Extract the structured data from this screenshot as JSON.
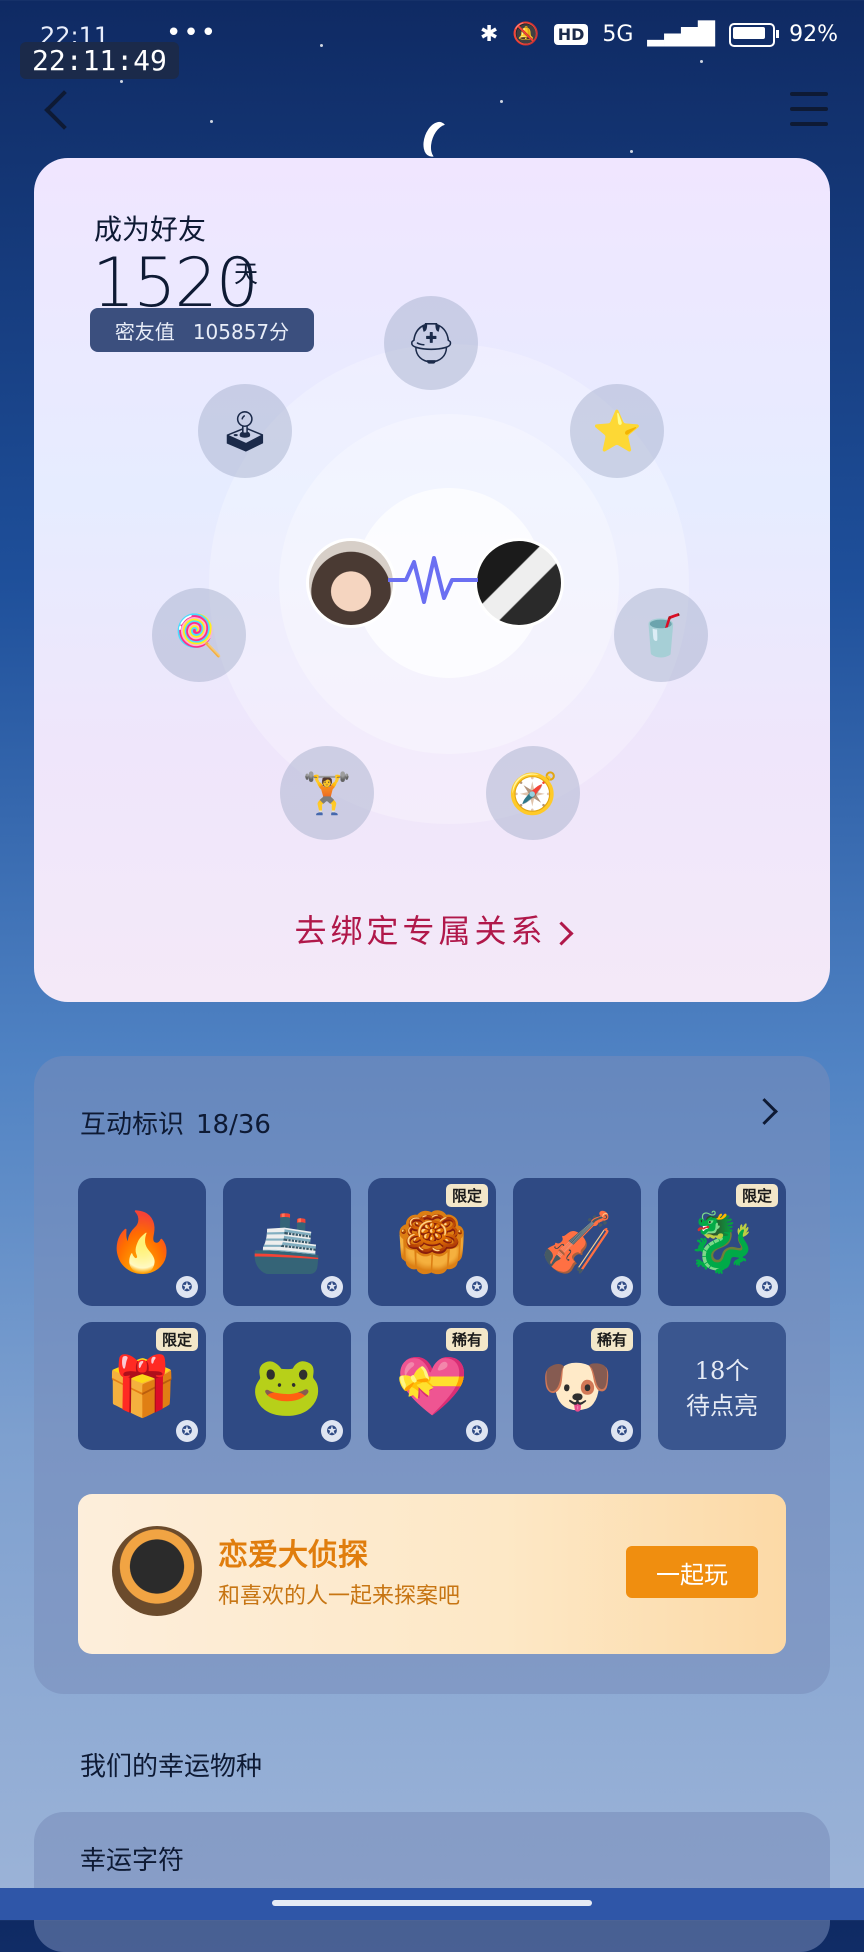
{
  "status_bar": {
    "time_small": "22:11",
    "time_overlay": "22:11:49",
    "more": "•••",
    "hd": "HD",
    "network": "5G",
    "battery": "92%"
  },
  "nav": {
    "back_icon": "back-chevron-icon",
    "menu_icon": "menu-icon"
  },
  "friendship": {
    "title": "成为好友",
    "days": "1520",
    "days_unit": "天",
    "intimacy_label": "密友值",
    "intimacy_value": "105857分",
    "bind_link": "去绑定专属关系",
    "badges": [
      {
        "name": "helmet-icon",
        "glyph": "⛑"
      },
      {
        "name": "joystick-icon",
        "glyph": "🕹"
      },
      {
        "name": "star-icon",
        "glyph": "⭐"
      },
      {
        "name": "popsicle-icon",
        "glyph": "🍭"
      },
      {
        "name": "drinks-icon",
        "glyph": "🥤"
      },
      {
        "name": "dumbbell-icon",
        "glyph": "🏋"
      },
      {
        "name": "compass-icon",
        "glyph": "🧭"
      }
    ]
  },
  "marks": {
    "title": "互动标识",
    "count": "18/36",
    "tiles": [
      {
        "name": "fire-99-icon",
        "glyph": "🔥",
        "tag": ""
      },
      {
        "name": "ship-icon",
        "glyph": "🚢",
        "tag": ""
      },
      {
        "name": "mooncake-icon",
        "glyph": "🥮",
        "tag": "限定"
      },
      {
        "name": "harp-icon",
        "glyph": "🎻",
        "tag": ""
      },
      {
        "name": "dragon-penguin-icon",
        "glyph": "🐉",
        "tag": "限定"
      },
      {
        "name": "gift-box-icon",
        "glyph": "🎁",
        "tag": "限定"
      },
      {
        "name": "frog-icon",
        "glyph": "🐸",
        "tag": ""
      },
      {
        "name": "rainbow-hearts-icon",
        "glyph": "💝",
        "tag": "稀有"
      },
      {
        "name": "dog-donut-icon",
        "glyph": "🐶",
        "tag": "稀有"
      }
    ],
    "pending_line1": "18个",
    "pending_line2": "待点亮"
  },
  "detective": {
    "title": "恋爱大侦探",
    "subtitle": "和喜欢的人一起来探案吧",
    "button": "一起玩"
  },
  "lucky_species": "我们的幸运物种",
  "lucky_char": "幸运字符"
}
